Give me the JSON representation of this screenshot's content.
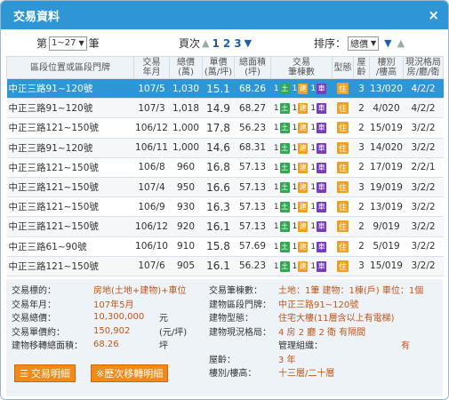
{
  "window": {
    "title": "交易資料",
    "close_glyph": "×"
  },
  "toolbar": {
    "range_prefix": "第",
    "range_value": "1~27",
    "range_suffix": "筆",
    "page_label": "頁次",
    "pages": [
      "1",
      "2",
      "3"
    ],
    "current_page": "1",
    "sort_label": "排序：",
    "sort_value": "總價"
  },
  "table": {
    "headers": [
      "區段位置或區段門牌",
      "交易\n年月",
      "總價\n(萬)",
      "單價\n(萬/坪)",
      "總面積\n(坪)",
      "交易\n筆棟數",
      "型態",
      "屋\n齡",
      "樓別\n/樓高",
      "現況格局\n房/廳/衛"
    ],
    "rows": [
      {
        "addr": "中正三路91~120號",
        "date": "107/5",
        "total": "1,030",
        "unit": "15.1",
        "area": "68.26",
        "land": "1",
        "bld": "1",
        "car": "1",
        "type": "住",
        "age": "3",
        "floor": "13/020",
        "layout": "4/2/2"
      },
      {
        "addr": "中正三路91~120號",
        "date": "107/3",
        "total": "1,018",
        "unit": "14.9",
        "area": "68.27",
        "land": "1",
        "bld": "1",
        "car": "1",
        "type": "住",
        "age": "2",
        "floor": "4/020",
        "layout": "4/2/2"
      },
      {
        "addr": "中正三路121~150號",
        "date": "106/12",
        "total": "1,000",
        "unit": "17.8",
        "area": "56.23",
        "land": "1",
        "bld": "1",
        "car": "1",
        "type": "住",
        "age": "2",
        "floor": "15/019",
        "layout": "3/2/2"
      },
      {
        "addr": "中正三路91~120號",
        "date": "106/11",
        "total": "1,000",
        "unit": "14.6",
        "area": "68.31",
        "land": "1",
        "bld": "1",
        "car": "1",
        "type": "住",
        "age": "3",
        "floor": "14/020",
        "layout": "3/2/2"
      },
      {
        "addr": "中正三路121~150號",
        "date": "106/8",
        "total": "960",
        "unit": "16.8",
        "area": "57.13",
        "land": "1",
        "bld": "1",
        "car": "1",
        "type": "住",
        "age": "2",
        "floor": "17/019",
        "layout": "2/2/1"
      },
      {
        "addr": "中正三路121~150號",
        "date": "107/4",
        "total": "950",
        "unit": "16.6",
        "area": "57.13",
        "land": "1",
        "bld": "1",
        "car": "1",
        "type": "住",
        "age": "3",
        "floor": "19/019",
        "layout": "3/2/2"
      },
      {
        "addr": "中正三路121~150號",
        "date": "106/9",
        "total": "930",
        "unit": "16.3",
        "area": "57.13",
        "land": "1",
        "bld": "1",
        "car": "1",
        "type": "住",
        "age": "2",
        "floor": "13/019",
        "layout": "3/2/2"
      },
      {
        "addr": "中正三路121~150號",
        "date": "106/12",
        "total": "920",
        "unit": "16.1",
        "area": "57.13",
        "land": "1",
        "bld": "1",
        "car": "1",
        "type": "住",
        "age": "2",
        "floor": "9/019",
        "layout": "3/2/2"
      },
      {
        "addr": "中正三路61~90號",
        "date": "106/10",
        "total": "910",
        "unit": "15.8",
        "area": "57.69",
        "land": "1",
        "bld": "1",
        "car": "1",
        "type": "住",
        "age": "2",
        "floor": "5/019",
        "layout": "3/2/2"
      },
      {
        "addr": "中正三路121~150號",
        "date": "107/6",
        "total": "905",
        "unit": "16.1",
        "area": "56.23",
        "land": "1",
        "bld": "1",
        "car": "1",
        "type": "住",
        "age": "3",
        "floor": "15/019",
        "layout": "3/2/2"
      }
    ],
    "badge_land": "土",
    "badge_bld": "建",
    "badge_car": "車"
  },
  "detail": {
    "left": [
      {
        "label": "交易標的：",
        "value": "房地(土地+建物)+車位",
        "unit": ""
      },
      {
        "label": "交易年月：",
        "value": "107年5月",
        "unit": ""
      },
      {
        "label": "交易總價：",
        "value": "10,300,000",
        "unit": "元"
      },
      {
        "label": "交易單價約：",
        "value": "150,902",
        "unit": "(元/坪)"
      },
      {
        "label": "建物移轉總面積：",
        "value": "68.26",
        "unit": "坪"
      }
    ],
    "right": [
      {
        "label": "交易筆棟數：",
        "value": "土地：1筆 建物：1棟(戶) 車位：1個"
      },
      {
        "label": "建物區段門牌：",
        "value": "中正三路91~120號"
      },
      {
        "label": "建物型態：",
        "value": "住宅大樓(11層含以上有電梯)"
      },
      {
        "label": "建物現況格局：",
        "value": "4 房 2 廳 2 衛 有隔間"
      },
      {
        "label": "",
        "value": "管理組織：",
        "extra": "有"
      },
      {
        "label": "屋齡：",
        "value": "3  年"
      },
      {
        "label": "樓別/樓高：",
        "value": "十三層/二十層"
      }
    ],
    "btn_detail": "交易明細",
    "btn_history": "※歷次移轉明細"
  },
  "colors": {
    "titlebar": "#2f96d5",
    "highlight": "#2f96d5",
    "accent": "#f08a18",
    "value_text": "#c0561a"
  }
}
